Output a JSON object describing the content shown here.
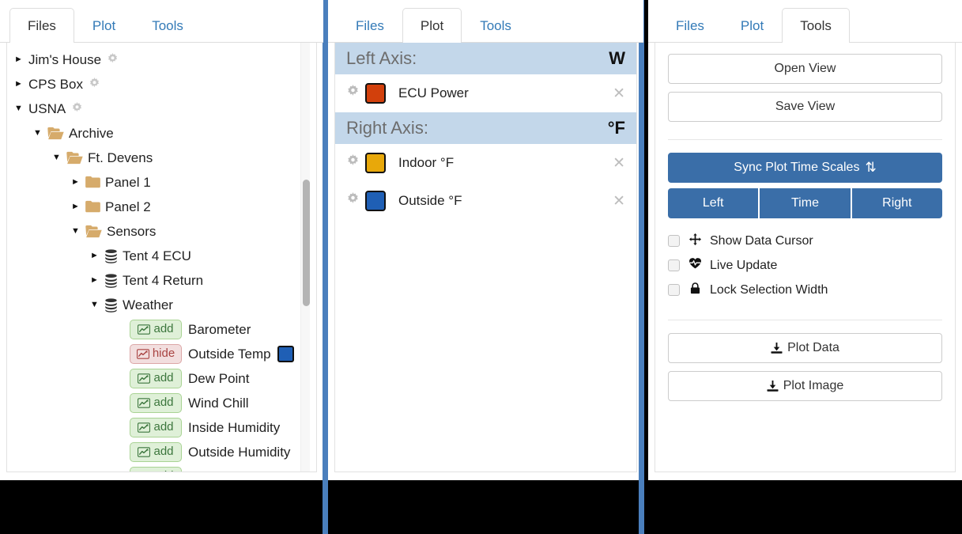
{
  "files_panel": {
    "tabs": [
      {
        "label": "Files",
        "active": true
      },
      {
        "label": "Plot",
        "active": false
      },
      {
        "label": "Tools",
        "active": false
      }
    ],
    "tree": [
      {
        "caret": "right",
        "icon": "none",
        "label": "Jim's House",
        "gear": true,
        "indent": 0
      },
      {
        "caret": "right",
        "icon": "none",
        "label": "CPS Box",
        "gear": true,
        "indent": 0
      },
      {
        "caret": "down",
        "icon": "none",
        "label": "USNA",
        "gear": true,
        "indent": 0
      },
      {
        "caret": "down",
        "icon": "folder-open",
        "label": "Archive",
        "gear": false,
        "indent": 1
      },
      {
        "caret": "down",
        "icon": "folder-open",
        "label": "Ft. Devens",
        "gear": false,
        "indent": 2
      },
      {
        "caret": "right",
        "icon": "folder",
        "label": "Panel 1",
        "gear": false,
        "indent": 3
      },
      {
        "caret": "right",
        "icon": "folder",
        "label": "Panel 2",
        "gear": false,
        "indent": 3
      },
      {
        "caret": "down",
        "icon": "folder-open",
        "label": "Sensors",
        "gear": false,
        "indent": 3
      },
      {
        "caret": "right",
        "icon": "database",
        "label": "Tent 4 ECU",
        "gear": false,
        "indent": 4
      },
      {
        "caret": "right",
        "icon": "database",
        "label": "Tent 4 Return",
        "gear": false,
        "indent": 4
      },
      {
        "caret": "down",
        "icon": "database",
        "label": "Weather",
        "gear": false,
        "indent": 4
      }
    ],
    "channels": [
      {
        "action": "add",
        "label": "Barometer",
        "swatch": null
      },
      {
        "action": "hide",
        "label": "Outside Temp",
        "swatch": "#1f5fb5"
      },
      {
        "action": "add",
        "label": "Dew Point",
        "swatch": null
      },
      {
        "action": "add",
        "label": "Wind Chill",
        "swatch": null
      },
      {
        "action": "add",
        "label": "Inside Humidity",
        "swatch": null
      },
      {
        "action": "add",
        "label": "Outside Humidity",
        "swatch": null
      },
      {
        "action": "add",
        "label": "",
        "swatch": null
      }
    ]
  },
  "plot_panel": {
    "tabs": [
      {
        "label": "Files",
        "active": false
      },
      {
        "label": "Plot",
        "active": true
      },
      {
        "label": "Tools",
        "active": false
      }
    ],
    "left_axis": {
      "title": "Left Axis:",
      "unit": "W",
      "series": [
        {
          "name": "ECU Power",
          "color": "#d2400c"
        }
      ]
    },
    "right_axis": {
      "title": "Right Axis:",
      "unit": "°F",
      "series": [
        {
          "name": "Indoor °F",
          "color": "#e8a80a"
        },
        {
          "name": "Outside °F",
          "color": "#1f5fb5"
        }
      ]
    }
  },
  "tools_panel": {
    "tabs": [
      {
        "label": "Files",
        "active": false
      },
      {
        "label": "Plot",
        "active": false
      },
      {
        "label": "Tools",
        "active": true
      }
    ],
    "open_view": "Open View",
    "save_view": "Save View",
    "sync_button": "Sync Plot Time Scales",
    "sync_icon": "arrows-up-down-icon",
    "segments": [
      "Left",
      "Time",
      "Right"
    ],
    "checkboxes": [
      {
        "label": "Show Data Cursor",
        "icon": "crosshair-move-icon",
        "checked": false
      },
      {
        "label": "Live Update",
        "icon": "heartbeat-icon",
        "checked": false
      },
      {
        "label": "Lock Selection Width",
        "icon": "lock-icon",
        "checked": false
      }
    ],
    "downloads": [
      {
        "label": "Plot Data",
        "icon": "download-icon"
      },
      {
        "label": "Plot Image",
        "icon": "download-icon"
      }
    ]
  },
  "colors": {
    "splitter": "#4a7fbd",
    "accent_blue": "#3a6ea8",
    "axis_header": "#c3d7ea",
    "tab_link": "#337ab7"
  }
}
